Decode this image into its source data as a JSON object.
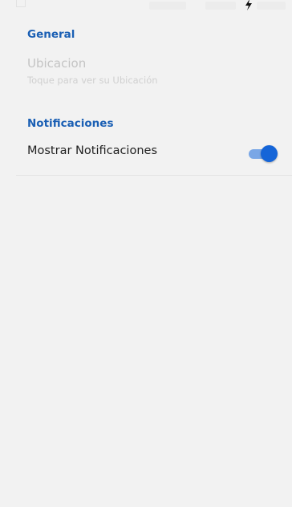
{
  "colors": {
    "background": "#f2f2f2",
    "section_header": "#1a5fb4",
    "switch_thumb": "#1565d8",
    "switch_track": "#7aa7e6",
    "disabled_text": "#c4c4c4",
    "primary_text": "#1f1f1f"
  },
  "status_bar": {
    "icons": [
      "image-icon",
      "charging-bolt-icon"
    ]
  },
  "settings": {
    "general": {
      "header": "General",
      "ubicacion": {
        "title": "Ubicacion",
        "summary": "Toque para ver su Ubicación",
        "enabled": false
      }
    },
    "notificaciones": {
      "header": "Notificaciones",
      "mostrar": {
        "title": "Mostrar Notificaciones",
        "switch_on": true
      }
    }
  }
}
